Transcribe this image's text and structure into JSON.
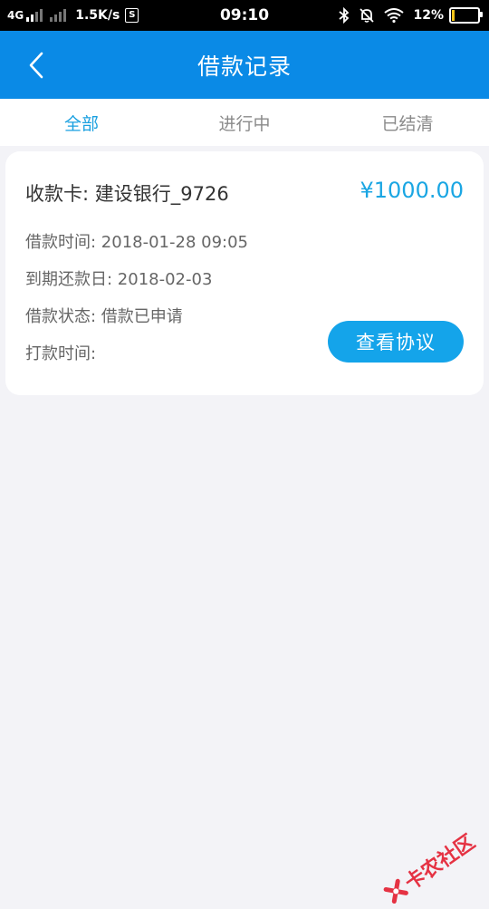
{
  "status_bar": {
    "network": "4G",
    "speed": "1.5K/s",
    "s_icon": "S",
    "time": "09:10",
    "battery_percent": "12%",
    "battery_level": 0.12
  },
  "header": {
    "title": "借款记录",
    "back_icon": "chevron-left-icon"
  },
  "tabs": [
    {
      "label": "全部",
      "active": true
    },
    {
      "label": "进行中",
      "active": false
    },
    {
      "label": "已结清",
      "active": false
    }
  ],
  "record": {
    "card_label": "收款卡: 建设银行_9726",
    "amount": "¥1000.00",
    "loan_time": "借款时间: 2018-01-28 09:05",
    "due_date": "到期还款日: 2018-02-03",
    "status": "借款状态: 借款已申请",
    "payout_time": "打款时间:",
    "view_agreement": "查看协议"
  },
  "watermark": {
    "text": "卡农社区"
  },
  "colors": {
    "header_bg": "#0a8ae6",
    "accent": "#1aa0e0",
    "button_bg": "#14a4ea",
    "page_bg": "#f3f3f7",
    "watermark": "#e5283a"
  }
}
